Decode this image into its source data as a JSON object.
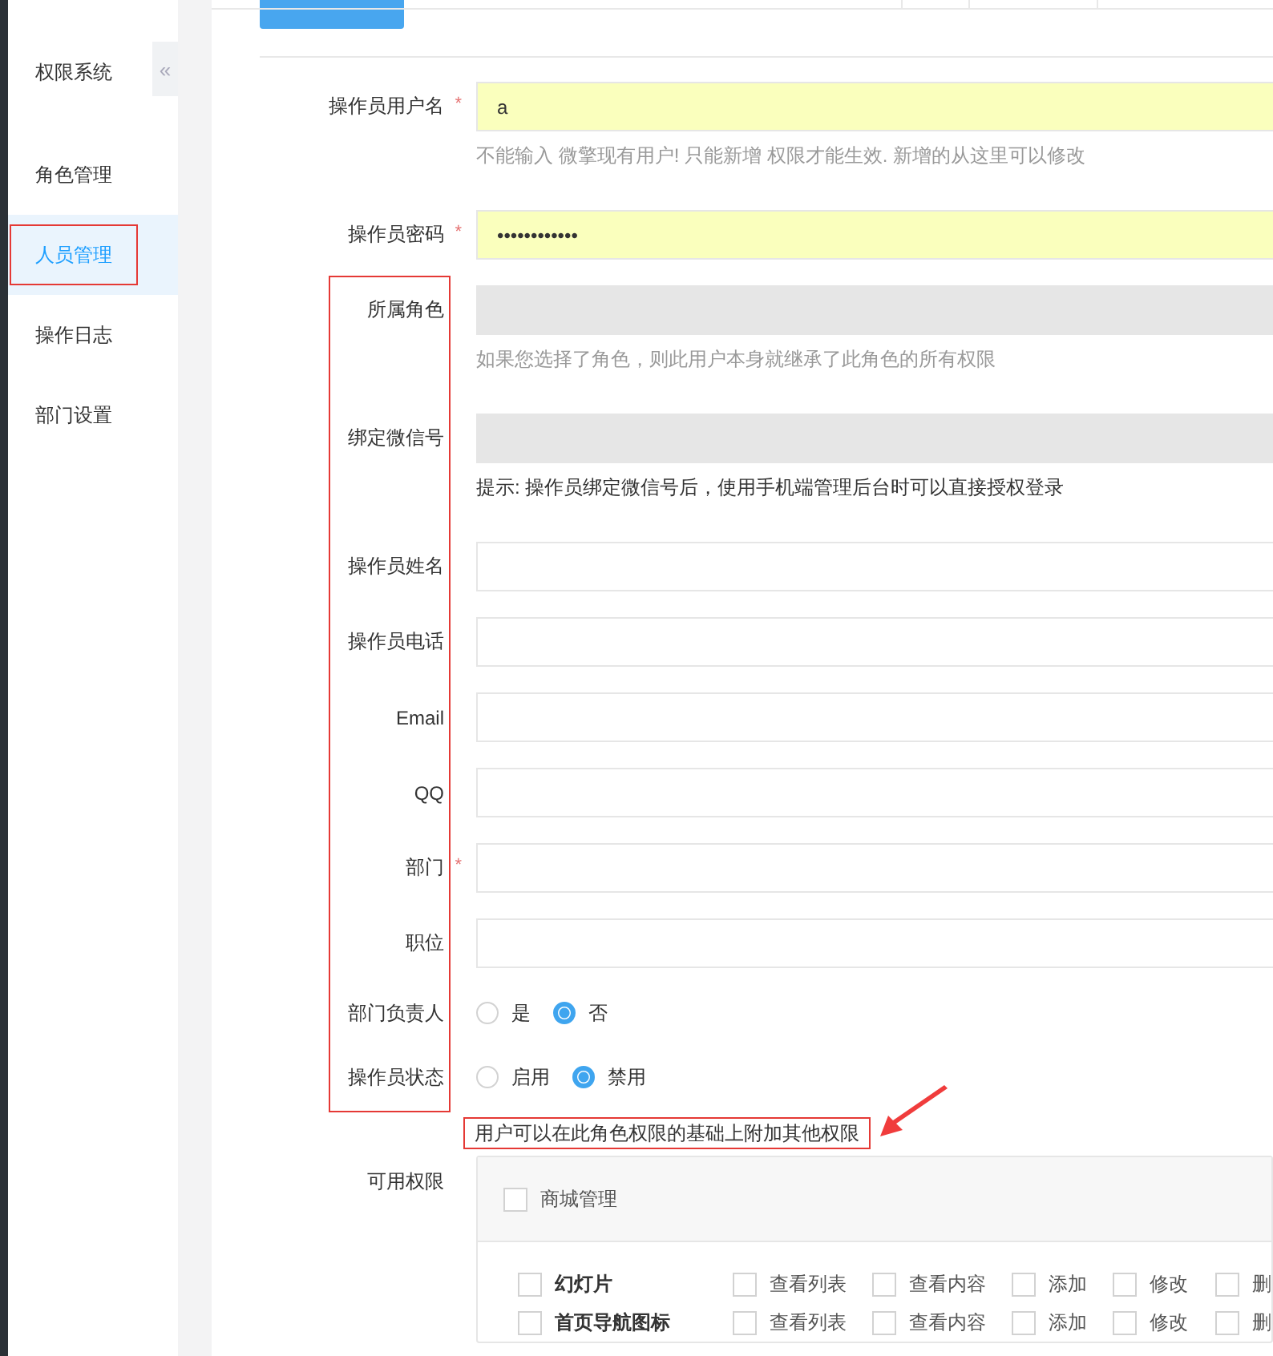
{
  "sidebar": {
    "title": "权限系统",
    "collapse_glyph": "«",
    "items": [
      {
        "label": "角色管理",
        "selected": false,
        "marked": false
      },
      {
        "label": "人员管理",
        "selected": true,
        "marked": true
      },
      {
        "label": "操作日志",
        "selected": false,
        "marked": false
      },
      {
        "label": "部门设置",
        "selected": false,
        "marked": false
      }
    ]
  },
  "form": {
    "labels_marked": true,
    "fields": [
      {
        "kind": "text",
        "label": "操作员用户名",
        "required_mark": "*",
        "value": "a",
        "autofilled": true,
        "disabled": false,
        "hint": "不能输入 微擎现有用户! 只能新增 权限才能生效. 新增的从这里可以修改",
        "hint_muted": true
      },
      {
        "kind": "text",
        "label": "操作员密码",
        "required_mark": "*",
        "value": "••••••••••••",
        "autofilled": true,
        "disabled": false
      },
      {
        "kind": "text",
        "label": "所属角色",
        "autofilled": false,
        "disabled": true,
        "hint": "如果您选择了角色，则此用户本身就继承了此角色的所有权限",
        "hint_muted": true
      },
      {
        "kind": "text",
        "label": "绑定微信号",
        "autofilled": false,
        "disabled": true,
        "hint": "提示: 操作员绑定微信号后，使用手机端管理后台时可以直接授权登录",
        "hint_muted": false
      },
      {
        "kind": "text",
        "label": "操作员姓名",
        "autofilled": false,
        "disabled": false
      },
      {
        "kind": "text",
        "label": "操作员电话",
        "autofilled": false,
        "disabled": false
      },
      {
        "kind": "text",
        "label": "Email",
        "autofilled": false,
        "disabled": false
      },
      {
        "kind": "text",
        "label": "QQ",
        "autofilled": false,
        "disabled": false
      },
      {
        "kind": "text",
        "label": "部门",
        "required_mark": "*",
        "autofilled": false,
        "disabled": false
      },
      {
        "kind": "text",
        "label": "职位",
        "autofilled": false,
        "disabled": false
      },
      {
        "kind": "radio",
        "label": "部门负责人",
        "options": [
          {
            "label": "是",
            "selected": false
          },
          {
            "label": "否",
            "selected": true
          }
        ]
      },
      {
        "kind": "radio",
        "label": "操作员状态",
        "options": [
          {
            "label": "启用",
            "selected": false
          },
          {
            "label": "禁用",
            "selected": true
          }
        ]
      }
    ],
    "note": "用户可以在此角色权限的基础上附加其他权限"
  },
  "permissions": {
    "label": "可用权限",
    "group": {
      "label": "商城管理",
      "checked": false
    },
    "rows": [
      {
        "name": "幻灯片",
        "checked": false,
        "actions": [
          {
            "label": "查看列表",
            "checked": false
          },
          {
            "label": "查看内容",
            "checked": false
          },
          {
            "label": "添加",
            "checked": false
          },
          {
            "label": "修改",
            "checked": false
          },
          {
            "label": "删",
            "checked": false
          }
        ]
      },
      {
        "name": "首页导航图标",
        "checked": false,
        "actions": [
          {
            "label": "查看列表",
            "checked": false
          },
          {
            "label": "查看内容",
            "checked": false
          },
          {
            "label": "添加",
            "checked": false
          },
          {
            "label": "修改",
            "checked": false
          },
          {
            "label": "删",
            "checked": false
          }
        ]
      }
    ]
  }
}
